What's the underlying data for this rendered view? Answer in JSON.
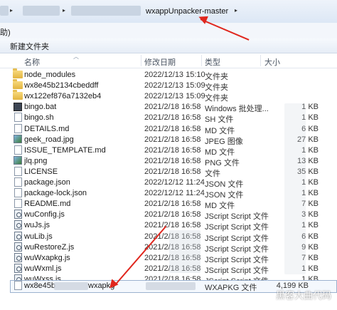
{
  "address": {
    "path_label": "wxappUnpacker-master",
    "separator": "▸"
  },
  "menu": {
    "item": "助)"
  },
  "toolbar": {
    "new_folder": "新建文件夹"
  },
  "columns": {
    "name": "名称",
    "modified": "修改日期",
    "type": "类型",
    "size": "大小"
  },
  "files": [
    {
      "name": "node_modules",
      "date": "2022/12/13 15:10",
      "type": "文件夹",
      "size": "",
      "icon": "folder"
    },
    {
      "name": "wx8e45b2134cbeddff",
      "date": "2022/12/13 15:09",
      "type": "文件夹",
      "size": "",
      "icon": "folder"
    },
    {
      "name": "wx122ef876a7132eb4",
      "date": "2022/12/13 15:09",
      "type": "文件夹",
      "size": "",
      "icon": "folder"
    },
    {
      "name": "bingo.bat",
      "date": "2021/2/18 16:58",
      "type": "Windows 批处理...",
      "size": "1 KB",
      "icon": "bat"
    },
    {
      "name": "bingo.sh",
      "date": "2021/2/18 16:58",
      "type": "SH 文件",
      "size": "1 KB",
      "icon": "file"
    },
    {
      "name": "DETAILS.md",
      "date": "2021/2/18 16:58",
      "type": "MD 文件",
      "size": "6 KB",
      "icon": "file"
    },
    {
      "name": "geek_road.jpg",
      "date": "2021/2/18 16:58",
      "type": "JPEG 图像",
      "size": "27 KB",
      "icon": "img"
    },
    {
      "name": "ISSUE_TEMPLATE.md",
      "date": "2021/2/18 16:58",
      "type": "MD 文件",
      "size": "1 KB",
      "icon": "file"
    },
    {
      "name": "jlq.png",
      "date": "2021/2/18 16:58",
      "type": "PNG 文件",
      "size": "13 KB",
      "icon": "img"
    },
    {
      "name": "LICENSE",
      "date": "2021/2/18 16:58",
      "type": "文件",
      "size": "35 KB",
      "icon": "file"
    },
    {
      "name": "package.json",
      "date": "2022/12/12 11:24",
      "type": "JSON 文件",
      "size": "1 KB",
      "icon": "file"
    },
    {
      "name": "package-lock.json",
      "date": "2022/12/12 11:24",
      "type": "JSON 文件",
      "size": "1 KB",
      "icon": "file"
    },
    {
      "name": "README.md",
      "date": "2021/2/18 16:58",
      "type": "MD 文件",
      "size": "7 KB",
      "icon": "file"
    },
    {
      "name": "wuConfig.js",
      "date": "2021/2/18 16:58",
      "type": "JScript Script 文件",
      "size": "3 KB",
      "icon": "script"
    },
    {
      "name": "wuJs.js",
      "date": "2021/2/18 16:58",
      "type": "JScript Script 文件",
      "size": "1 KB",
      "icon": "script"
    },
    {
      "name": "wuLib.js",
      "date": "2021/2/18 16:58",
      "type": "JScript Script 文件",
      "size": "6 KB",
      "icon": "script"
    },
    {
      "name": "wuRestoreZ.js",
      "date": "2021/2/18 16:58",
      "type": "JScript Script 文件",
      "size": "9 KB",
      "icon": "script"
    },
    {
      "name": "wuWxapkg.js",
      "date": "2021/2/18 16:58",
      "type": "JScript Script 文件",
      "size": "7 KB",
      "icon": "script"
    },
    {
      "name": "wuWxml.js",
      "date": "2021/2/18 16:58",
      "type": "JScript Script 文件",
      "size": "1 KB",
      "icon": "script"
    },
    {
      "name": "wuWxss.js",
      "date": "2021/2/18 16:58",
      "type": "JScript Script 文件",
      "size": "1 KB",
      "icon": "script"
    }
  ],
  "selected_file": {
    "name_prefix": "wx8e45b",
    "name_suffix": "wxapkg",
    "type": "WXAPKG 文件",
    "size": "4,199 KB",
    "icon": "file"
  },
  "watermark": "黑客大曲代码",
  "accent_colors": {
    "annotation_arrow": "#e0261d",
    "selection_border": "#9cb2cf"
  }
}
